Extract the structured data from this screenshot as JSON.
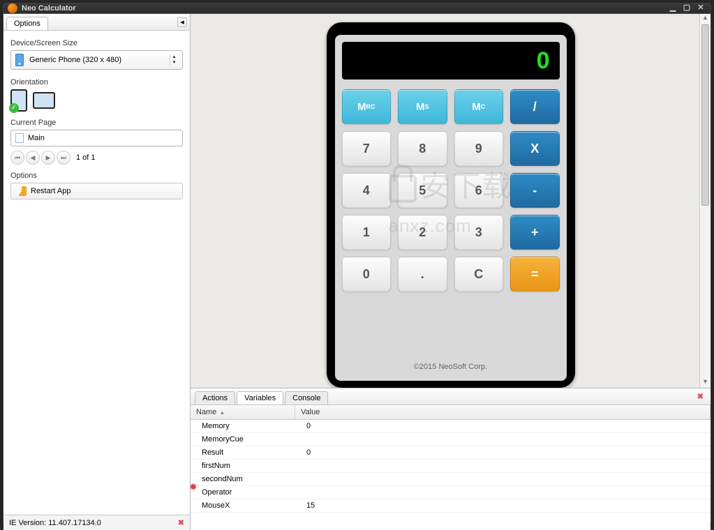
{
  "window": {
    "title": "Neo Calculator"
  },
  "sidebar": {
    "tab_label": "Options",
    "device_label": "Device/Screen Size",
    "device_value": "Generic Phone (320 x 480)",
    "orientation_label": "Orientation",
    "current_page_label": "Current Page",
    "current_page_value": "Main",
    "pager_text": "1 of 1",
    "options_label": "Options",
    "restart_label": "Restart App"
  },
  "statusbar": {
    "text": "IE Version: 11.407.17134.0"
  },
  "calc": {
    "display": "0",
    "keys": [
      {
        "label": "Mʀc",
        "cls": "mem"
      },
      {
        "label": "Ms",
        "cls": "mem"
      },
      {
        "label": "Mc",
        "cls": "mem"
      },
      {
        "label": "/",
        "cls": "op"
      },
      {
        "label": "7",
        "cls": "num"
      },
      {
        "label": "8",
        "cls": "num"
      },
      {
        "label": "9",
        "cls": "num"
      },
      {
        "label": "X",
        "cls": "op"
      },
      {
        "label": "4",
        "cls": "num"
      },
      {
        "label": "5",
        "cls": "num"
      },
      {
        "label": "6",
        "cls": "num"
      },
      {
        "label": "-",
        "cls": "op"
      },
      {
        "label": "1",
        "cls": "num"
      },
      {
        "label": "2",
        "cls": "num"
      },
      {
        "label": "3",
        "cls": "num"
      },
      {
        "label": "+",
        "cls": "op"
      },
      {
        "label": "0",
        "cls": "num"
      },
      {
        "label": ".",
        "cls": "num"
      },
      {
        "label": "C",
        "cls": "num"
      },
      {
        "label": "=",
        "cls": "eq"
      }
    ],
    "footer": "©2015 NeoSoft Corp."
  },
  "bottom": {
    "tabs": [
      "Actions",
      "Variables",
      "Console"
    ],
    "active_tab": 1,
    "header": {
      "name": "Name",
      "value": "Value"
    },
    "rows": [
      {
        "name": "Memory",
        "value": "0"
      },
      {
        "name": "MemoryCue",
        "value": ""
      },
      {
        "name": "Result",
        "value": "0"
      },
      {
        "name": "firstNum",
        "value": ""
      },
      {
        "name": "secondNum",
        "value": ""
      },
      {
        "name": "Operator",
        "value": ""
      },
      {
        "name": "MouseX",
        "value": "15"
      }
    ]
  },
  "watermark": "安下载\nanxz.com"
}
